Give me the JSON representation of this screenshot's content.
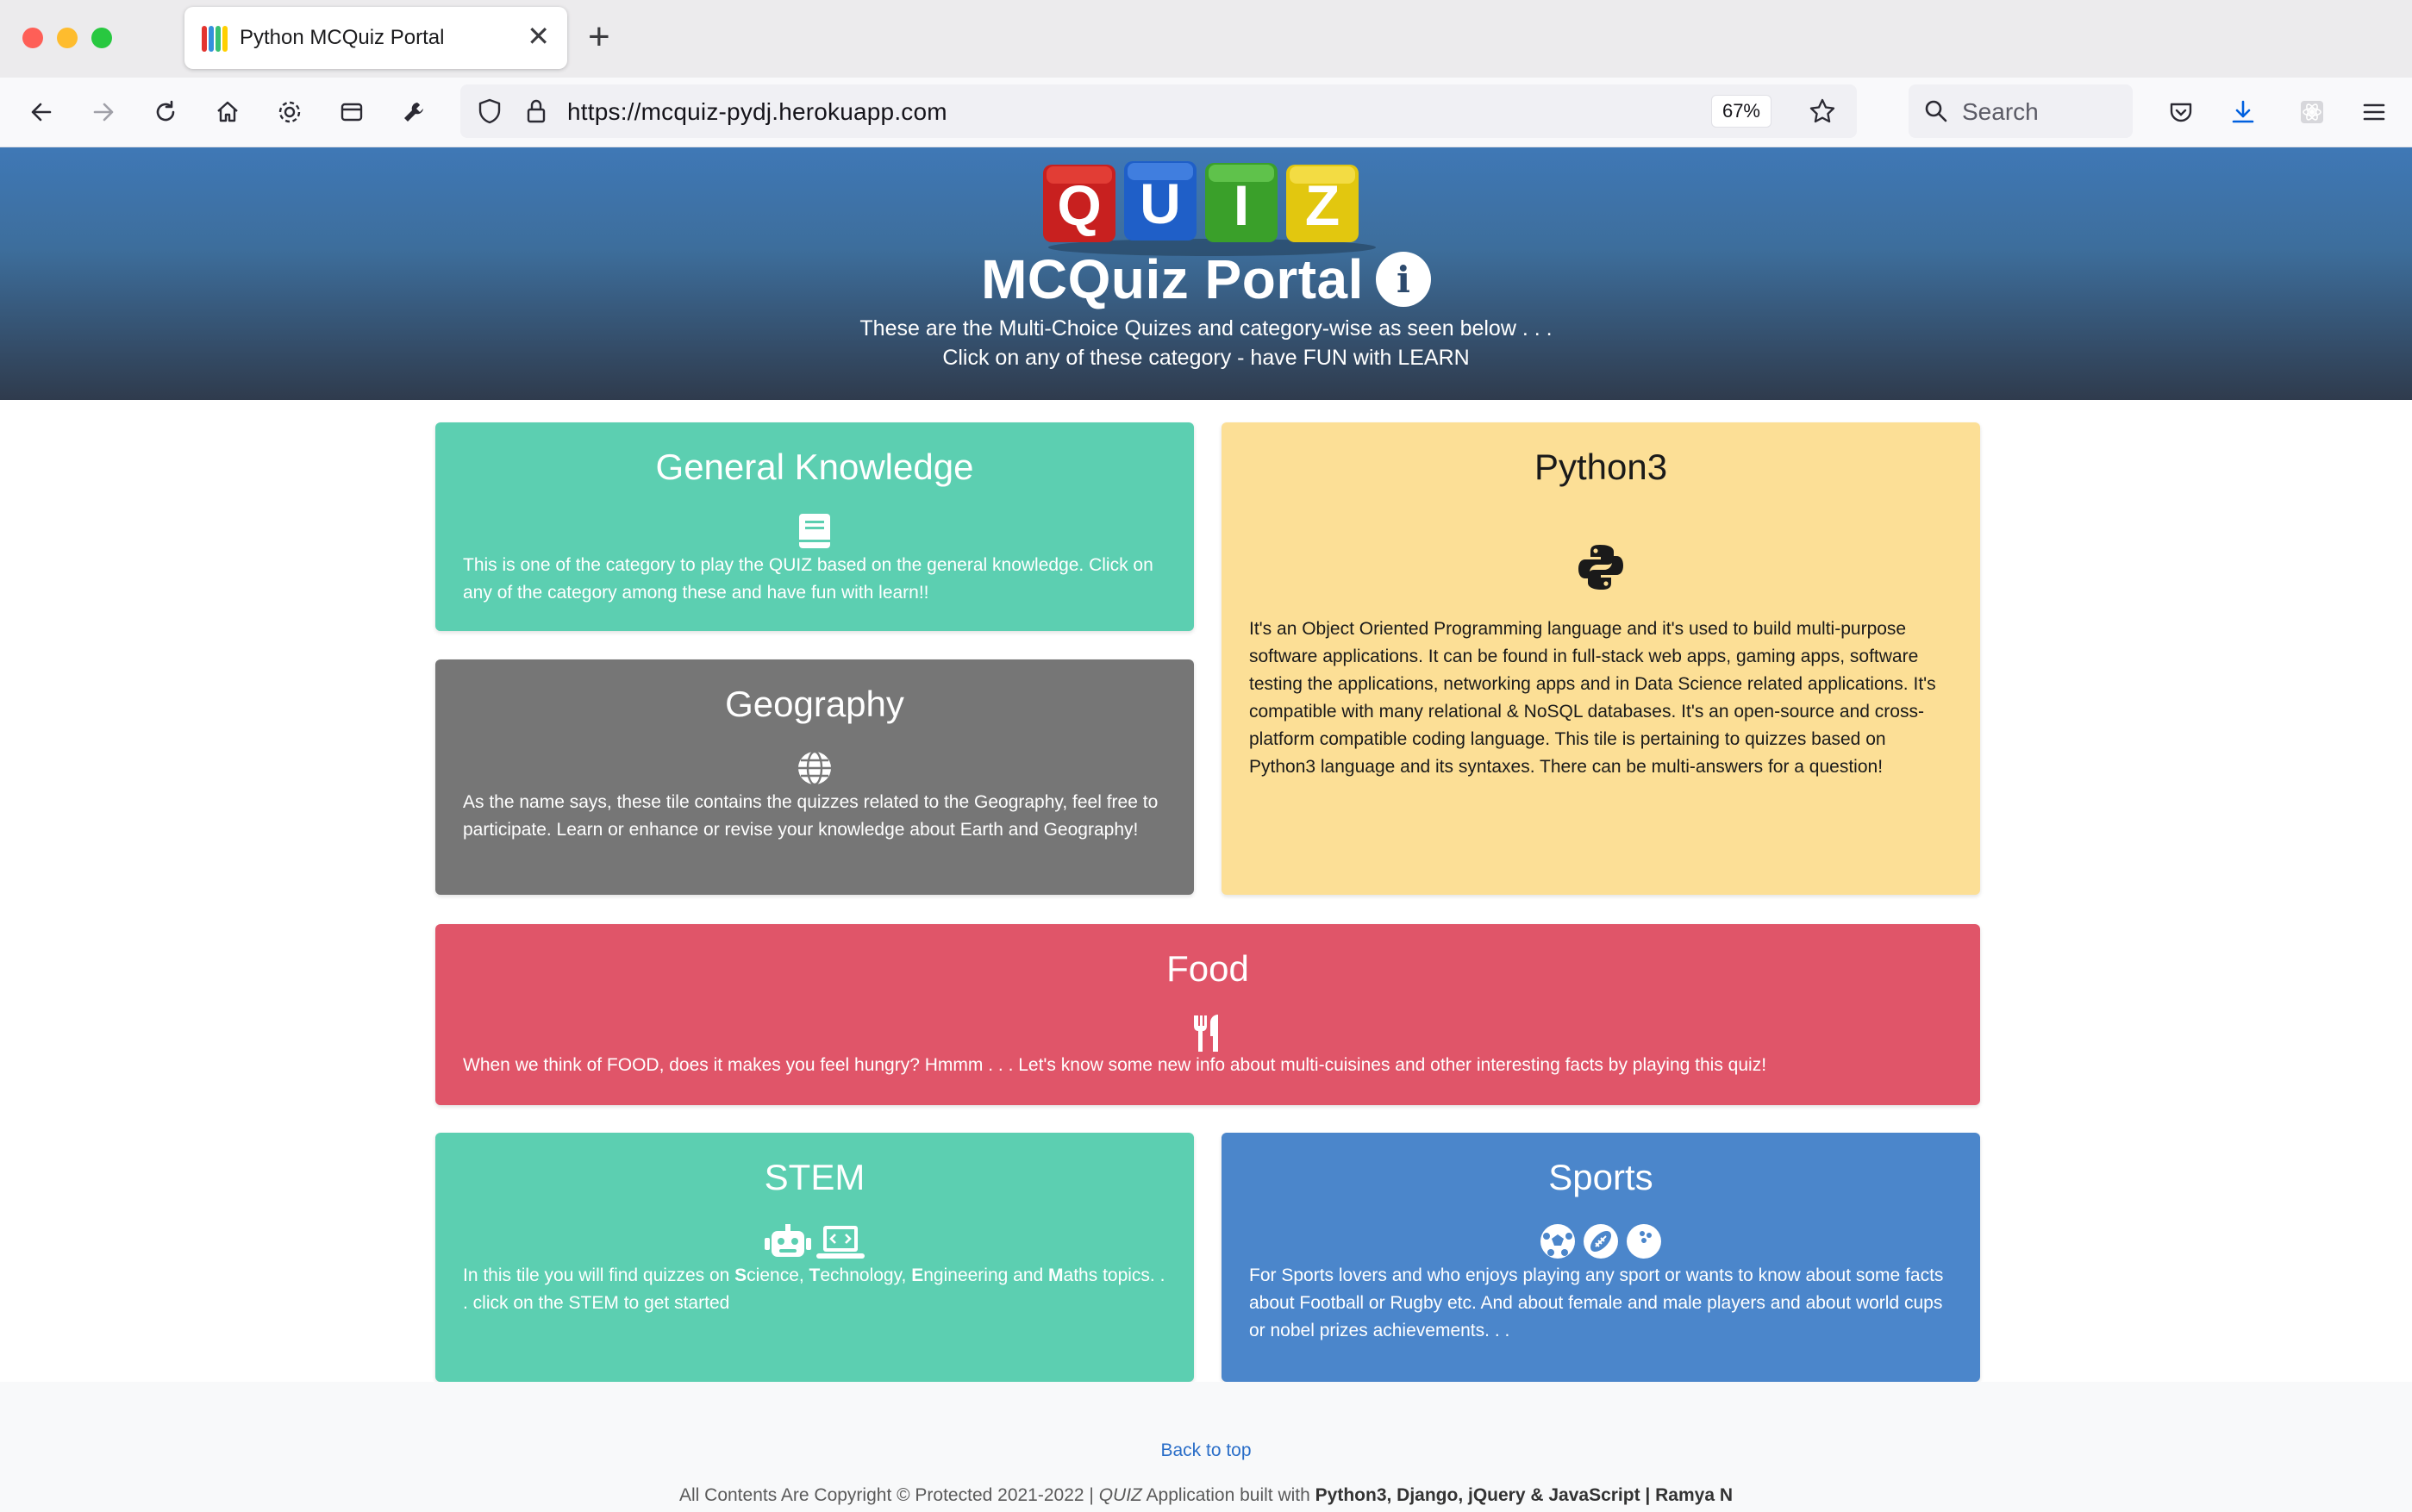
{
  "browser": {
    "tab_title": "Python MCQuiz Portal",
    "url": "https://mcquiz-pydj.herokuapp.com",
    "zoom": "67%",
    "search_placeholder": "Search"
  },
  "hero": {
    "logo_letters": [
      "Q",
      "U",
      "I",
      "Z"
    ],
    "title": "MCQuiz Portal",
    "subtitle_line1": "These are the Multi-Choice Quizes and category-wise as seen below . . .",
    "subtitle_line2": "Click on any of these category - have FUN with LEARN"
  },
  "categories": [
    {
      "title": "General Knowledge",
      "icon": "book-icon",
      "color": "#5ccfb1",
      "description": "This is one of the category to play the QUIZ based on the general knowledge. Click on any of the category among these and have fun with learn!!"
    },
    {
      "title": "Python3",
      "icon": "python-icon",
      "color": "#fcdf96",
      "description": "It's an Object Oriented Programming language and it's used to build multi-purpose software applications. It can be found in full-stack web apps, gaming apps, software testing the applications, networking apps and in Data Science related applications. It's compatible with many relational & NoSQL databases. It's an open-source and cross-platform compatible coding language. This tile is pertaining to quizzes based on Python3 language and its syntaxes. There can be multi-answers for a question!"
    },
    {
      "title": "Geography",
      "icon": "globe-icon",
      "color": "#767676",
      "description": "As the name says, these tile contains the quizzes related to the Geography, feel free to participate. Learn or enhance or revise your knowledge about Earth and Geography!"
    },
    {
      "title": "Food",
      "icon": "utensils-icon",
      "color": "#e05569",
      "description": "When we think of FOOD, does it makes you feel hungry? Hmmm . . . Let's know some new info about multi-cuisines and other interesting facts by playing this quiz!"
    },
    {
      "title": "STEM",
      "icon": "robot-laptop-icon",
      "color": "#5ccfb1",
      "description_parts": [
        "In this tile you will find quizzes on ",
        "S",
        "cience, ",
        "T",
        "echnology, ",
        "E",
        "ngineering and ",
        "M",
        "aths topics. . . click on the STEM to get started"
      ]
    },
    {
      "title": "Sports",
      "icon": "balls-icon",
      "color": "#4b86cb",
      "description": "For Sports lovers and who enjoys playing any sport or wants to know about some facts about Football or Rugby etc. And about female and male players and about world cups or nobel prizes achievements. . ."
    }
  ],
  "footer": {
    "back_to_top": "Back to top",
    "copyright_prefix": "All Contents Are Copyright © Protected 2021-2022 | ",
    "copyright_app": "QUIZ",
    "copyright_mid": " Application built with ",
    "copyright_tech": "Python3, Django, jQuery & JavaScript | Ramya N"
  }
}
